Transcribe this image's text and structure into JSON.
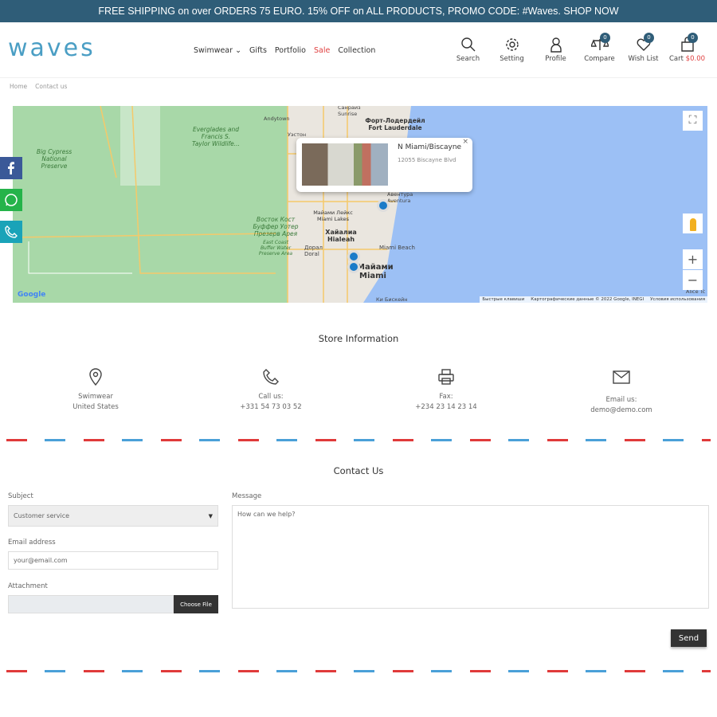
{
  "topbar": {
    "text": "FREE SHIPPING on over ORDERS 75 EURO. 15% OFF on ALL PRODUCTS, PROMO CODE: #Waves. SHOP NOW"
  },
  "header": {
    "logo": "waves",
    "nav": [
      {
        "label": "Swimwear"
      },
      {
        "label": "Gifts"
      },
      {
        "label": "Portfolio"
      },
      {
        "label": "Sale"
      },
      {
        "label": "Collection"
      }
    ],
    "icons": {
      "search": "Search",
      "setting": "Setting",
      "profile": "Profile",
      "compare": "Compare",
      "compare_count": "0",
      "wishlist": "Wish List",
      "wishlist_count": "0",
      "cart": "Cart",
      "cart_total": "$0.00",
      "cart_count": "0"
    }
  },
  "breadcrumb": [
    "Home",
    "Contact us"
  ],
  "map": {
    "popup_title": "N Miami/Biscayne",
    "popup_address": "12055 Biscayne Blvd",
    "close": "×",
    "labels": [
      "Big Cypress National Preserve",
      "Everglades and Francis S. Taylor Wildlife...",
      "Andytown",
      "Санрайз Sunrise",
      "Форт-Лодердейл Fort Lauderdale",
      "Уэстон",
      "Майами Лейкс Miami Lakes",
      "Хайалиа Hialeah",
      "Восток Кост Буффер Уотер Презерв Арея",
      "East Coast Buffer Water Preserve Area",
      "Дорал Doral",
      "Miami Beach",
      "Майами Miami",
      "Ки Бискейн",
      "Авентура Aventura",
      "Alice Tc"
    ],
    "attribution": [
      "Быстрые клавиши",
      "Картографические данные © 2022 Google, INEGI",
      "Условия использования"
    ],
    "google": "Google",
    "zoom_in": "+",
    "zoom_out": "−"
  },
  "store": {
    "title": "Store Information",
    "items": [
      {
        "line1": "Swimwear",
        "line2": "United States"
      },
      {
        "line1": "Call us:",
        "line2": "+331 54 73 03 52"
      },
      {
        "line1": "Fax:",
        "line2": "+234 23 14 23 14"
      },
      {
        "line1": "Email us:",
        "line2": "demo@demo.com"
      }
    ]
  },
  "contact": {
    "title": "Contact Us",
    "subject_label": "Subject",
    "subject_value": "Customer service",
    "email_label": "Email address",
    "email_placeholder": "your@email.com",
    "attachment_label": "Attachment",
    "choose_file": "Choose File",
    "message_label": "Message",
    "message_placeholder": "How can we help?",
    "send": "Send"
  },
  "colors": {
    "accent": "#2f5d78",
    "logo": "#4a9ec4",
    "sale": "#e04040"
  }
}
